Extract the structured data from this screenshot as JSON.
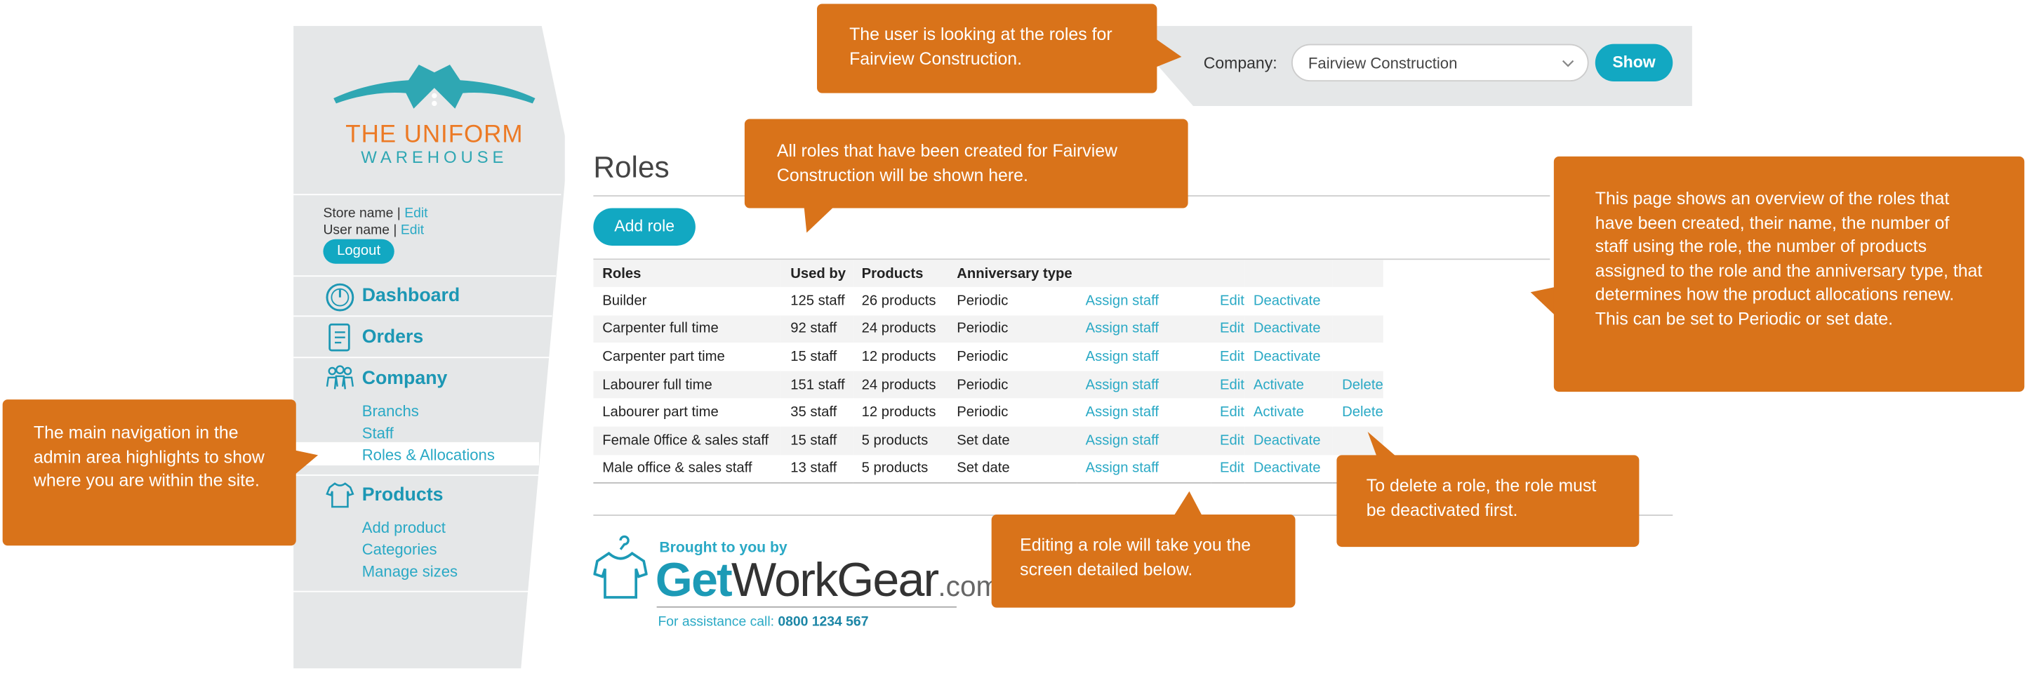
{
  "logo": {
    "line1": "THE UNIFORM",
    "line2": "WAREHOUSE"
  },
  "account": {
    "store_label": "Store name",
    "user_label": "User name",
    "separator": " | ",
    "edit_label": "Edit",
    "logout_label": "Logout"
  },
  "nav": {
    "dashboard": "Dashboard",
    "orders": "Orders",
    "company": "Company",
    "company_items": [
      "Branchs",
      "Staff",
      "Roles & Allocations"
    ],
    "products": "Products",
    "products_items": [
      "Add product",
      "Categories",
      "Manage sizes"
    ]
  },
  "topbar": {
    "company_label": "Company:",
    "company_value": "Fairview Construction",
    "show_label": "Show"
  },
  "main": {
    "title": "Roles",
    "add_role_label": "Add role",
    "columns": [
      "Roles",
      "Used by",
      "Products",
      "Anniversary type"
    ],
    "rows": [
      {
        "role": "Builder",
        "used_by": "125 staff",
        "products": "26 products",
        "anniversary": "Periodic",
        "assign": "Assign staff",
        "edit": "Edit",
        "status_action": "Deactivate",
        "delete": ""
      },
      {
        "role": "Carpenter full time",
        "used_by": "92 staff",
        "products": "24 products",
        "anniversary": "Periodic",
        "assign": "Assign staff",
        "edit": "Edit",
        "status_action": "Deactivate",
        "delete": ""
      },
      {
        "role": "Carpenter part time",
        "used_by": "15 staff",
        "products": "12 products",
        "anniversary": "Periodic",
        "assign": "Assign staff",
        "edit": "Edit",
        "status_action": "Deactivate",
        "delete": ""
      },
      {
        "role": "Labourer full time",
        "used_by": "151 staff",
        "products": "24 products",
        "anniversary": "Periodic",
        "assign": "Assign staff",
        "edit": "Edit",
        "status_action": "Activate",
        "delete": "Delete"
      },
      {
        "role": "Labourer part time",
        "used_by": "35 staff",
        "products": "12 products",
        "anniversary": "Periodic",
        "assign": "Assign staff",
        "edit": "Edit",
        "status_action": "Activate",
        "delete": "Delete"
      },
      {
        "role": "Female 0ffice & sales staff",
        "used_by": "15 staff",
        "products": "5 products",
        "anniversary": "Set date",
        "assign": "Assign staff",
        "edit": "Edit",
        "status_action": "Deactivate",
        "delete": ""
      },
      {
        "role": "Male office & sales staff",
        "used_by": "13 staff",
        "products": "5 products",
        "anniversary": "Set date",
        "assign": "Assign staff",
        "edit": "Edit",
        "status_action": "Deactivate",
        "delete": ""
      }
    ]
  },
  "footer": {
    "brought_by": "Brought to you by",
    "brand_get": "Get",
    "brand_work": "WorkGear",
    "brand_com": ".com",
    "assist_label": "For assistance call:",
    "assist_phone": "0800 1234 567"
  },
  "callouts": {
    "company": "The user is looking at the roles for Fairview Construction.",
    "roles": "All roles that have been created for Fairview Construction will be shown here.",
    "overview": "This page shows an overview of the roles that have been created, their name, the number of staff using the role, the number of products assigned to the role and the anniversary type, that determines how the product allocations renew. This can be set to Periodic or set date.",
    "navigation": "The main navigation in the admin area highlights to show where you are within the site.",
    "delete": "To delete a role, the role must be deactivated first.",
    "edit": "Editing a role will take you the screen detailed below."
  },
  "colors": {
    "accent": "#12a8c2",
    "callout": "#d9731a",
    "sidebar": "#e5e7e8",
    "logo_orange": "#ec7a25"
  }
}
